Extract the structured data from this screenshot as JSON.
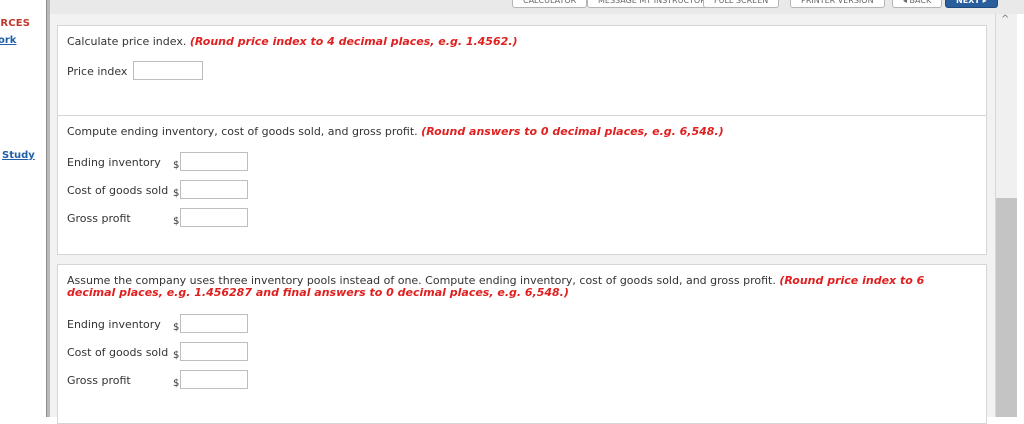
{
  "sidebar": {
    "resources_title": "URCES",
    "resources_link": "ork",
    "study_link": "Study"
  },
  "toolbar": {
    "calculator": "CALCULATOR",
    "message": "MESSAGE MY INSTRUCTOR",
    "full_screen": "FULL SCREEN",
    "printer": "PRINTER VERSION",
    "back": "◂ BACK",
    "next": "NEXT ▸"
  },
  "q1": {
    "prompt": "Calculate price index.",
    "instruction": "(Round price index to 4 decimal places, e.g. 1.4562.)",
    "price_index_label": "Price index",
    "price_index_value": ""
  },
  "q2": {
    "prompt": "Compute ending inventory, cost of goods sold, and gross profit.",
    "instruction": "(Round answers to 0 decimal places, e.g. 6,548.)",
    "currency": "$",
    "rows": [
      {
        "label": "Ending inventory",
        "value": ""
      },
      {
        "label": "Cost of goods sold",
        "value": ""
      },
      {
        "label": "Gross profit",
        "value": ""
      }
    ]
  },
  "q3": {
    "prompt": "Assume the company uses three inventory pools instead of one. Compute ending inventory, cost of goods sold, and gross profit.",
    "instruction": "(Round price index to 6 decimal places, e.g. 1.456287 and final answers to 0 decimal places, e.g. 6,548.)",
    "currency": "$",
    "rows": [
      {
        "label": "Ending inventory",
        "value": ""
      },
      {
        "label": "Cost of goods sold",
        "value": ""
      },
      {
        "label": "Gross profit",
        "value": ""
      }
    ]
  },
  "colors": {
    "instruction_red": "#e02020",
    "link_blue": "#1f5fa8",
    "next_button": "#2a5d9c"
  },
  "icons": {
    "scroll_up": "chevron-up-icon"
  }
}
